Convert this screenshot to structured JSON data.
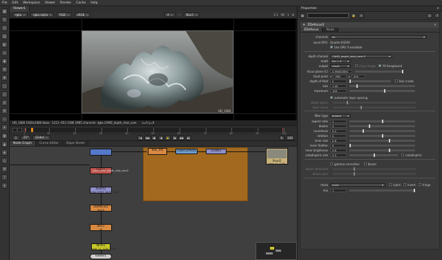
{
  "app": {
    "menu": [
      "File",
      "Edit",
      "Workspace",
      "Viewer",
      "Render",
      "Cache",
      "Help"
    ]
  },
  "viewer": {
    "tab": "Viewer1",
    "channel_set": "rgba",
    "alpha": "rgba.alpha",
    "colorspace": "RGB",
    "lut": "sRGB",
    "input_a": "A",
    "input_b": "Blur1",
    "zoom": "1:1",
    "gain_label": "f/8",
    "gamma": "1",
    "format_label": "HD_1080",
    "info_left": "HD_1080 1920x1080  bbox: -1213 -653 3186 1965 channels: rgba.CAMZ_depth_shot_cam",
    "info_right": "x=0 y=0"
  },
  "timeline": {
    "frame": "1",
    "start": "1",
    "marks": [
      "1",
      "10",
      "20",
      "30",
      "40",
      "50",
      "60",
      "70",
      "80",
      "90",
      "100"
    ],
    "end": "100",
    "fps": "25*",
    "mode": "Global",
    "cursor_frame": 3
  },
  "graph": {
    "tabs": [
      "Node Graph",
      "Curve Editor",
      "Dope Sheet"
    ],
    "nodes": {
      "read_a": "",
      "copy1": "Copy1",
      "copy1_sub": "rgba.CAMZ_depth_shot_cam2",
      "invert": "Invert2",
      "invert_sub": "rgba.CAMZ_depth_shot",
      "defocus": "ZDefocus2",
      "defocus_sub": "depth",
      "blur1": "Blur1",
      "blur1_sub": "all",
      "write": "Write1",
      "write_sub": "shot_11_1240_temp",
      "viewer": "Viewer1",
      "blur_depth": "Blur_dst",
      "colorcorrect": "ColorCorrect1",
      "grade": "Grade1",
      "read": "Read2",
      "read_sub": "shot_11_1240"
    }
  },
  "properties": {
    "title": "Properties",
    "node_field": "",
    "node_title": "ZDefocus2",
    "tabs": [
      "ZDefocus",
      "Node"
    ],
    "channels": "all",
    "local_gpu": "Quadro K4200",
    "use_gpu": "Use GPU if available",
    "depth_channel": "CAMZ_depth_shot_cam.Z",
    "math": "far = 0",
    "output": "result",
    "show_image": "show image",
    "fill_foreground": "fill foreground",
    "focus_plane": "0.99832694",
    "focal_point_x": "956",
    "focal_point_y": "410",
    "depth_of_field": "0",
    "blur_inside": "blur inside",
    "size": "1.00",
    "maximum": "100",
    "auto_layer": "automatic layer spacing",
    "depth_layers": "depth layers",
    "layer_curve": "layer curve",
    "filter_type": "bladed",
    "aspect_ratio": "1",
    "blades": "5",
    "roundness": "0.2",
    "rotation": "0",
    "inner_size": "0.6",
    "inner_feather": "0",
    "inner_brightness": "0.6",
    "catadioptric_size": "0.5",
    "catadioptric": "catadioptric",
    "gamma_correction": "gamma correction",
    "bloom": "bloom",
    "bloom_threshold": "bloom threshold",
    "bloom_gain": "bloom gain",
    "mask": "none",
    "inject": "inject",
    "invert": "invert",
    "fringe": "fringe",
    "mix": "1"
  },
  "labels": {
    "channels": "channels",
    "local_gpu": "Local GPU:",
    "depth_channel": "depth channel",
    "math": "math",
    "output": "output",
    "focus_plane": "focus plane (C)",
    "focal_point": "focal point",
    "depth_of_field": "depth of field",
    "size": "size",
    "maximum": "maximum",
    "depth_layers": "depth layers",
    "layer_curve": "layer curve",
    "filter_type": "filter type",
    "aspect_ratio": "aspect ratio",
    "blades": "blades",
    "roundness": "roundness",
    "rotation": "rotation",
    "inner_size": "inner size",
    "inner_feather": "inner feather",
    "inner_brightness": "inner brightness",
    "catadioptric_size": "catadioptric size",
    "bloom_threshold": "bloom threshold",
    "bloom_gain": "bloom gain",
    "mask": "mask",
    "mix": "mix"
  },
  "colors": {
    "accent": "#e08a20",
    "backdrop": "#a36a1f",
    "node_blue": "#5579c9",
    "node_red": "#c0544c",
    "node_orange": "#d88a43",
    "node_yellow": "#c8c82a"
  }
}
